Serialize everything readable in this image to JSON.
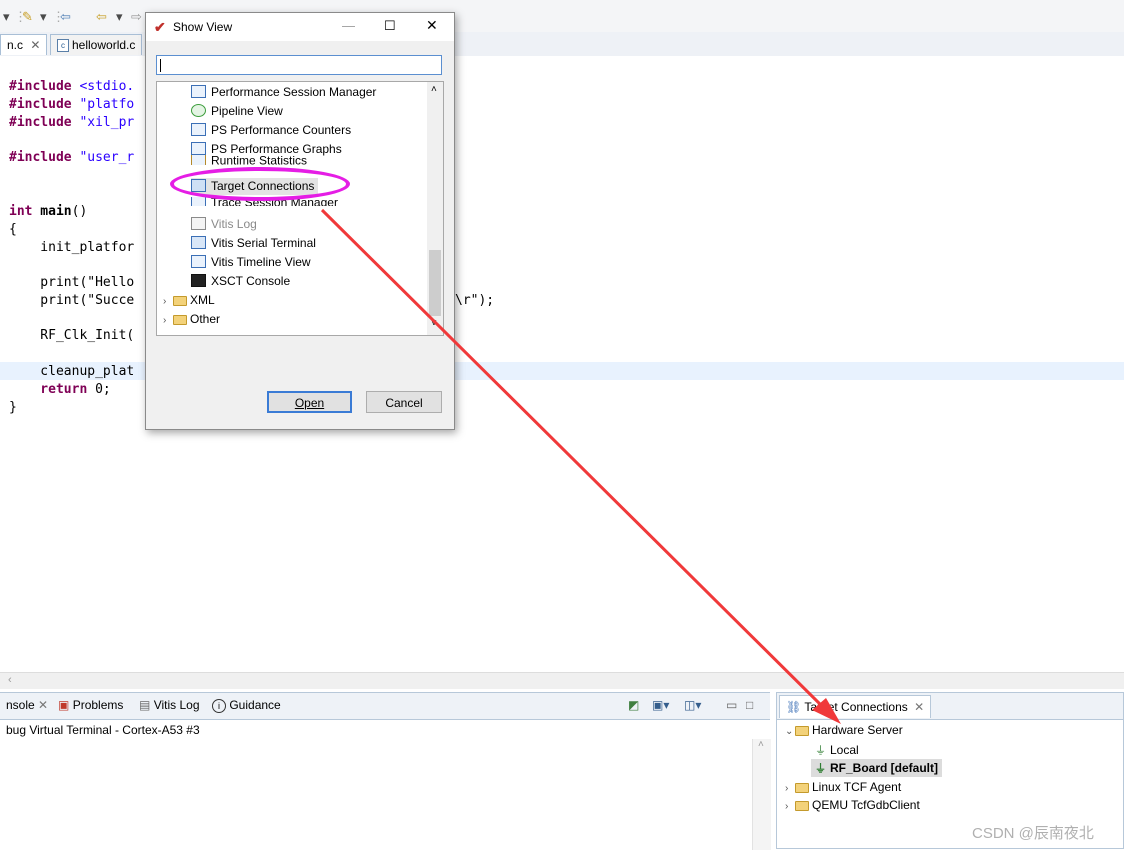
{
  "toolbar": {
    "icons": [
      "dropdown-icon",
      "pin-icon",
      "back-icon",
      "forward-icon"
    ]
  },
  "editor": {
    "tabs": [
      {
        "label": "n.c",
        "close": "✕"
      },
      {
        "label": "helloworld.c"
      }
    ],
    "code_lines": [
      {
        "kw": "#include",
        "rest": " <stdio."
      },
      {
        "kw": "#include",
        "rest": " \"platfo"
      },
      {
        "kw": "#include",
        "rest": " \"xil_pr"
      },
      {
        "kw": "#include",
        "rest": " \"user_r"
      },
      {
        "kw": "int",
        "bold2": " main",
        "rest": "()"
      },
      {
        "rest": "{"
      },
      {
        "rest": "    init_platfor"
      },
      {
        "rest": "    print(\"Hello"
      },
      {
        "rest": "    print(\"Succe"
      },
      {
        "rest": "\\r\");"
      },
      {
        "rest": "    RF_Clk_Init("
      },
      {
        "rest": "    cleanup_plat"
      },
      {
        "kw": "    return",
        "rest": " 0;"
      },
      {
        "rest": "}"
      }
    ]
  },
  "bottom_left": {
    "tabs": [
      "nsole",
      "Problems",
      "Vitis Log",
      "Guidance"
    ],
    "subtitle": "bug Virtual Terminal - Cortex-A53 #3"
  },
  "target_connections": {
    "tab_label": "Target Connections",
    "tree": [
      {
        "label": "Hardware Server",
        "expanded": true
      },
      {
        "label": "Local"
      },
      {
        "label": "RF_Board [default]",
        "selected": true
      },
      {
        "label": "Linux TCF Agent"
      },
      {
        "label": "QEMU TcfGdbClient"
      }
    ]
  },
  "dialog": {
    "title": "Show View",
    "filter_value": "",
    "items": [
      "Performance Session Manager",
      "Pipeline View",
      "PS Performance Counters",
      "PS Performance Graphs",
      "Runtime Statistics",
      "Target Connections",
      "Trace Session Manager",
      "Vitis Log",
      "Vitis Serial Terminal",
      "Vitis Timeline View",
      "XSCT Console"
    ],
    "folders": [
      "XML",
      "Other"
    ],
    "open_label": "Open",
    "cancel_label": "Cancel"
  },
  "annotation": {
    "highlight_color": "#e51de5",
    "arrow_color": "#f0393a"
  },
  "watermark": "CSDN @辰南夜北"
}
